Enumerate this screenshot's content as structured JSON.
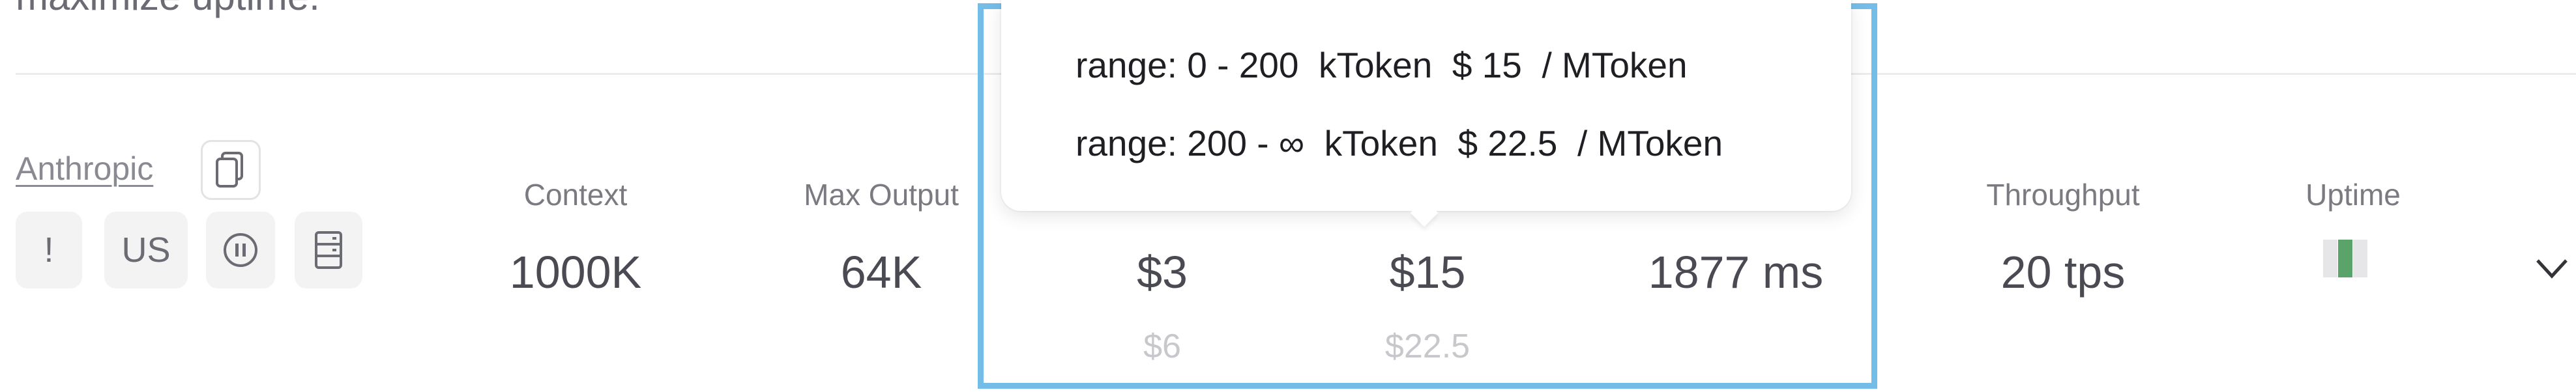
{
  "description_text": "maximize uptime.",
  "provider": {
    "name": "Anthropic",
    "chips": [
      {
        "label": "!",
        "icon": "exclamation-icon"
      },
      {
        "label": "US",
        "icon": "region-us"
      },
      {
        "label": "",
        "icon": "pause-circle-icon"
      },
      {
        "label": "",
        "icon": "server-icon"
      }
    ]
  },
  "columns": {
    "context": {
      "label": "Context",
      "value": "1000K"
    },
    "max_output": {
      "label": "Max Output",
      "value": "64K"
    },
    "input": {
      "value": "$3",
      "sub": "$6"
    },
    "output": {
      "value": "$15",
      "sub": "$22.5"
    },
    "latency": {
      "value": "1877 ms"
    },
    "throughput": {
      "label": "Throughput",
      "value": "20 tps"
    },
    "uptime": {
      "label": "Uptime",
      "bars": [
        "#e6e6e8",
        "#5aa469",
        "#e6e6e8"
      ]
    }
  },
  "tooltip": {
    "lines": [
      "range: 0 - 200  kToken  $ 15  / MToken",
      "range: 200 - ∞  kToken  $ 22.5  / MToken"
    ]
  },
  "colors": {
    "highlight": "#74bde8",
    "uptime_green": "#5aa469"
  }
}
